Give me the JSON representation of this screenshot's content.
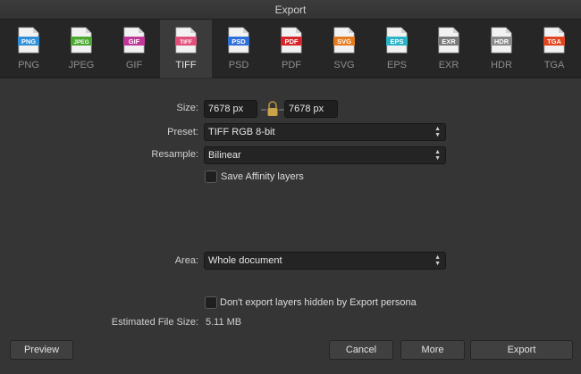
{
  "window": {
    "title": "Export"
  },
  "formats": [
    {
      "label": "PNG",
      "badge": "PNG",
      "color": "#2f8fd8"
    },
    {
      "label": "JPEG",
      "badge": "JPEG",
      "color": "#4aa82f"
    },
    {
      "label": "GIF",
      "badge": "GIF",
      "color": "#c0399a"
    },
    {
      "label": "TIFF",
      "badge": "TIFF",
      "color": "#e0507a",
      "active": true
    },
    {
      "label": "PSD",
      "badge": "PSD",
      "color": "#2f6fd8"
    },
    {
      "label": "PDF",
      "badge": "PDF",
      "color": "#d8262b"
    },
    {
      "label": "SVG",
      "badge": "SVG",
      "color": "#e67a1e"
    },
    {
      "label": "EPS",
      "badge": "EPS",
      "color": "#2bb3c8"
    },
    {
      "label": "EXR",
      "badge": "EXR",
      "color": "#7a7a7a"
    },
    {
      "label": "HDR",
      "badge": "HDR",
      "color": "#8a8a8a"
    },
    {
      "label": "TGA",
      "badge": "TGA",
      "color": "#e0451e"
    }
  ],
  "form": {
    "size_label": "Size:",
    "width_value": "7678 px",
    "height_value": "7678 px",
    "preset_label": "Preset:",
    "preset_value": "TIFF RGB 8-bit",
    "resample_label": "Resample:",
    "resample_value": "Bilinear",
    "save_layers_label": "Save Affinity layers",
    "area_label": "Area:",
    "area_value": "Whole document",
    "hidden_layers_label": "Don't export layers hidden by Export persona",
    "filesize_label": "Estimated File Size:",
    "filesize_value": "5.11 MB"
  },
  "buttons": {
    "preview": "Preview",
    "cancel": "Cancel",
    "more": "More",
    "export": "Export"
  },
  "colors": {
    "lock": "#c9a24a"
  }
}
